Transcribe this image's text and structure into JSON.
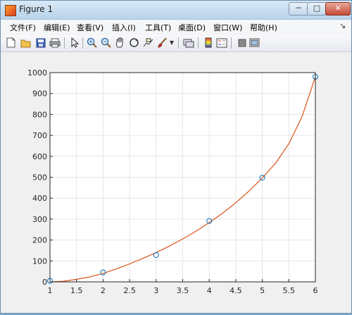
{
  "window": {
    "title": "Figure 1",
    "buttons": {
      "minimize": "─",
      "maximize": "□",
      "close": "✕"
    }
  },
  "menu": {
    "items": [
      "文件(F)",
      "编辑(E)",
      "查看(V)",
      "插入(I)",
      "工具(T)",
      "桌面(D)",
      "窗口(W)",
      "帮助(H)"
    ],
    "overflow": "↘"
  },
  "toolbar": {
    "icons": [
      "new-figure-icon",
      "open-file-icon",
      "save-icon",
      "print-icon",
      "pointer-icon",
      "zoom-in-icon",
      "zoom-out-icon",
      "pan-hand-icon",
      "rotate-3d-icon",
      "data-cursor-icon",
      "brush-icon",
      "brush-dropdown-icon",
      "link-plot-icon",
      "colorbar-icon",
      "legend-icon",
      "hide-plot-tools-icon",
      "show-plot-tools-icon"
    ]
  },
  "colors": {
    "curve": "#d95319",
    "markers": "#0072bd",
    "grid": "#e6e6e6",
    "axes": "#262626"
  },
  "chart_data": {
    "type": "scatter",
    "title": "",
    "xlabel": "",
    "ylabel": "",
    "xlim": [
      1,
      6
    ],
    "ylim": [
      0,
      1000
    ],
    "xticks": [
      "1",
      "1.5",
      "2",
      "2.5",
      "3",
      "3.5",
      "4",
      "4.5",
      "5",
      "5.5",
      "6"
    ],
    "yticks": [
      "0",
      "100",
      "200",
      "300",
      "400",
      "500",
      "600",
      "700",
      "800",
      "900",
      "1000"
    ],
    "grid": true,
    "legend": "none",
    "series": [
      {
        "marker": "circle",
        "x": [
          1,
          2,
          3,
          4,
          5,
          6
        ],
        "y": [
          5,
          45,
          128,
          291,
          498,
          980
        ]
      },
      {
        "line": "fitted curve",
        "x": [
          1,
          1.25,
          1.5,
          1.75,
          2,
          2.25,
          2.5,
          2.75,
          3,
          3.25,
          3.5,
          3.75,
          4,
          4.25,
          4.5,
          4.75,
          5,
          5.25,
          5.5,
          5.75,
          6
        ],
        "y": [
          0,
          3,
          12,
          24,
          40,
          62,
          86,
          112,
          140,
          171,
          205,
          242,
          283,
          328,
          378,
          434,
          497,
          567,
          660,
          790,
          980
        ]
      }
    ]
  }
}
